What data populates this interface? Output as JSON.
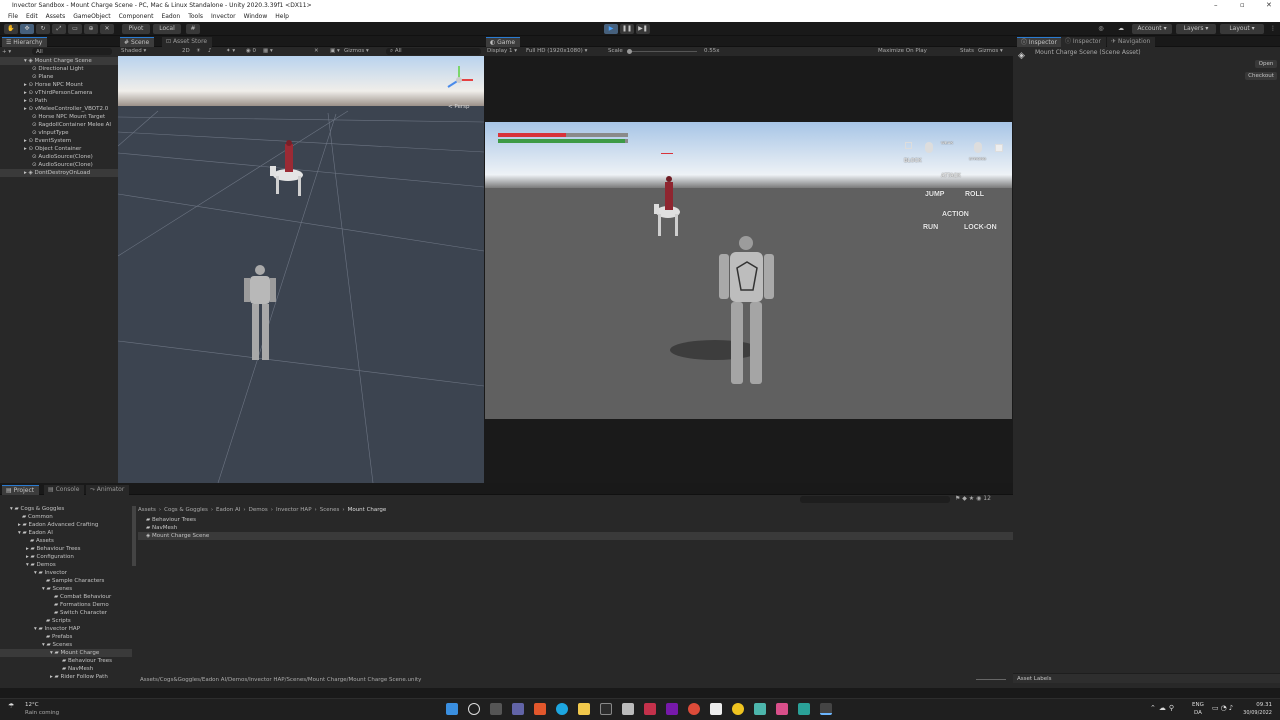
{
  "window": {
    "title": "Invector Sandbox - Mount Charge Scene - PC, Mac & Linux Standalone - Unity 2020.3.39f1 <DX11>"
  },
  "menu": [
    "File",
    "Edit",
    "Assets",
    "GameObject",
    "Component",
    "Eadon",
    "Tools",
    "Invector",
    "Window",
    "Help"
  ],
  "toolbar": {
    "pivot": "Pivot",
    "local": "Local",
    "account": "Account",
    "layers": "Layers",
    "layout": "Layout"
  },
  "hierarchy": {
    "tab": "Hierarchy",
    "search_placeholder": "All",
    "scene": "Mount Charge Scene",
    "items": [
      "Directional Light",
      "Plane",
      "Horse NPC Mount",
      "vThirdPersonCamera",
      "Path",
      "vMeleeController_VBOT2.0",
      "Horse NPC Mount Target",
      "RagdollContainer Melee AI",
      "vInputType",
      "EventSystem",
      "Object Container",
      "AudioSource(Clone)",
      "AudioSource(Clone)"
    ],
    "dontdestroy": "DontDestroyOnLoad"
  },
  "scene_view": {
    "tab": "Scene",
    "tab2": "Asset Store",
    "shading": "Shaded",
    "mode_2d": "2D",
    "gizmos": "Gizmos",
    "search": "All",
    "persp": "< Persp"
  },
  "game_view": {
    "tab": "Game",
    "display": "Display 1",
    "resolution": "Full HD (1920x1080)",
    "scale_label": "Scale",
    "scale_value": "0.55x",
    "maximize": "Maximize On Play",
    "stats": "Stats",
    "gizmos": "Gizmos"
  },
  "hud": {
    "jump": "JUMP",
    "roll": "ROLL",
    "action": "ACTION",
    "run": "RUN",
    "lockon": "LOCK-ON",
    "block": "BLOCK",
    "attack": "ATTACK",
    "weak": "WEAK",
    "strong": "STRONG",
    "weakattack": "WEAK ATTACK",
    "strongattack": "STRONG ATTACK",
    "lock": "LOCK"
  },
  "hud_bars": {
    "health_color": "#d8333b",
    "stamina_color": "#3d9a45",
    "health_fraction": 0.52,
    "stamina_fraction": 0.98
  },
  "inspector": {
    "tab": "Inspector",
    "tab2": "Inspector",
    "tab3": "Navigation",
    "asset": "Mount Charge Scene (Scene Asset)",
    "open": "Open",
    "checkout": "Checkout",
    "asset_labels": "Asset Labels"
  },
  "project": {
    "tabs": [
      "Project",
      "Console",
      "Animator"
    ],
    "tree": [
      "Cogs & Goggles",
      "Common",
      "Eadon Advanced Crafting",
      "Eadon AI",
      "Assets",
      "Behaviour Trees",
      "Configuration",
      "Demos",
      "Invector",
      "Sample Characters",
      "Scenes",
      "Combat Behaviour",
      "Formations Demo",
      "Switch Character",
      "Scripts",
      "Invector HAP",
      "Prefabs",
      "Scenes",
      "Mount Charge",
      "Behaviour Trees",
      "NavMesh",
      "Rider Follow Path"
    ],
    "breadcrumb": [
      "Assets",
      "Cogs & Goggles",
      "Eadon AI",
      "Demos",
      "Invector HAP",
      "Scenes",
      "Mount Charge"
    ],
    "files": [
      "Behaviour Trees",
      "NavMesh",
      "Mount Charge Scene"
    ],
    "path": "Assets/Cogs&Goggles/Eadon AI/Demos/Invector HAP/Scenes/Mount Charge/Mount Charge Scene.unity",
    "count": "12"
  },
  "taskbar": {
    "temp": "12°C",
    "weather": "Rain coming",
    "lang1": "ENG",
    "lang2": "DA",
    "time": "09.31",
    "date": "30/09/2022"
  }
}
